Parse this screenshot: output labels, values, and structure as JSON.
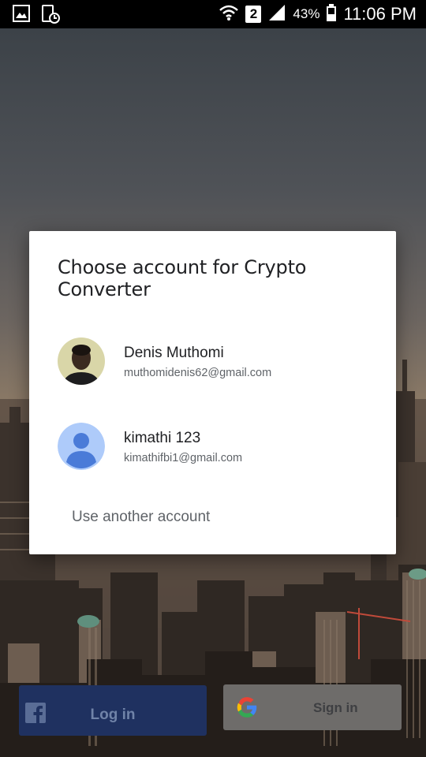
{
  "status_bar": {
    "sim_slot": "2",
    "battery_percent": "43%",
    "time": "11:06 PM",
    "icons": [
      "gallery-icon",
      "screenshot-icon",
      "wifi-icon",
      "signal-icon",
      "battery-icon"
    ]
  },
  "dialog": {
    "title": "Choose account for Crypto Converter",
    "accounts": [
      {
        "name": "Denis Muthomi",
        "email": "muthomidenis62@gmail.com",
        "avatar": "photo"
      },
      {
        "name": "kimathi 123",
        "email": "kimathifbi1@gmail.com",
        "avatar": "default-person"
      }
    ],
    "use_another": "Use another account"
  },
  "buttons": {
    "facebook_label": "Log in",
    "google_label": "Sign in"
  },
  "colors": {
    "dialog_bg": "#ffffff",
    "facebook_button": "#1f3160",
    "google_button": "#6e6c6a",
    "default_avatar_bg": "#aecbfa",
    "default_avatar_fg": "#4a7bd8"
  }
}
